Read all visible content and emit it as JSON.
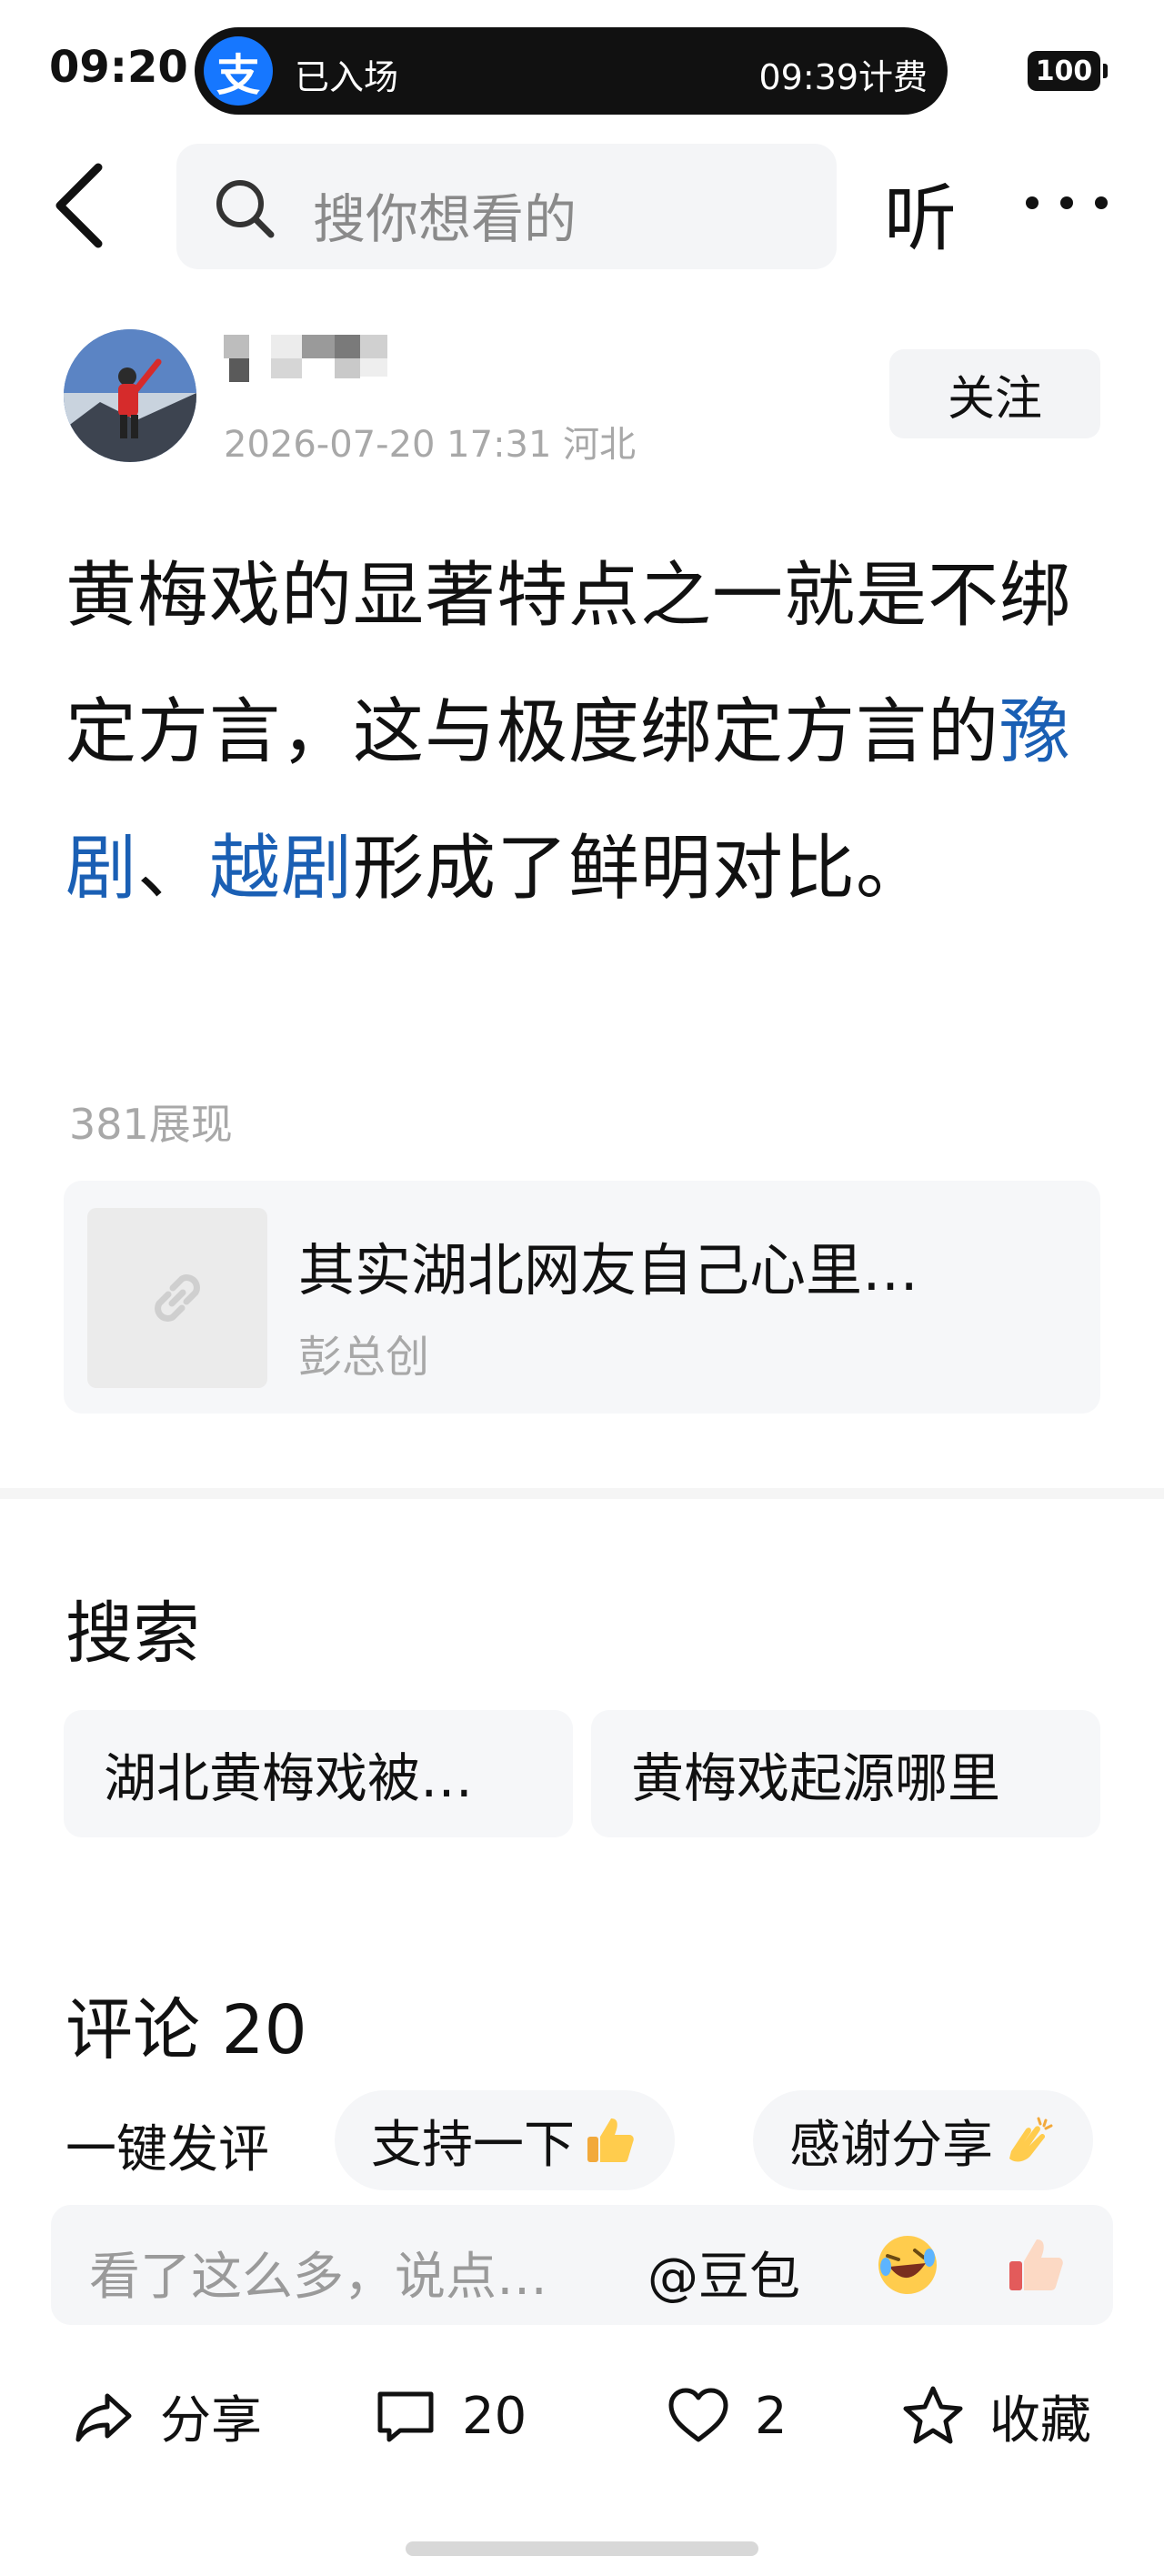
{
  "status_bar": {
    "time": "09:20",
    "pill_logo": "支",
    "pill_status": "已入场",
    "pill_fee": "09:39计费",
    "battery": "100"
  },
  "top_bar": {
    "search_placeholder": "搜你想看的",
    "listen_label": "听"
  },
  "author": {
    "meta": "2026-07-20 17:31 河北",
    "follow_label": "关注"
  },
  "post": {
    "text_before": "黄梅戏的显著特点之一就是不绑定方言，这与极度绑定方言的",
    "tag1": "豫剧",
    "sep": "、",
    "tag2": "越剧",
    "text_after": "形成了鲜明对比。",
    "views": "381展现"
  },
  "link_card": {
    "title": "其实湖北网友自己心里…",
    "source": "彭总创"
  },
  "search_section": {
    "title": "搜索",
    "chips": [
      "湖北黄梅戏被…",
      "黄梅戏起源哪里"
    ]
  },
  "comments": {
    "title": "评论 20",
    "quick_label": "一键发评",
    "quick_chips": [
      "支持一下",
      "感谢分享"
    ],
    "placeholder": "看了这么多，说点…",
    "at_label": "@豆包"
  },
  "actions": {
    "share": "分享",
    "comment": "20",
    "like": "2",
    "favorite": "收藏"
  },
  "colors": {
    "tag_link": "#1a5fb4",
    "alipay_blue": "#1677ff",
    "muted_text": "#a8a8a8"
  }
}
